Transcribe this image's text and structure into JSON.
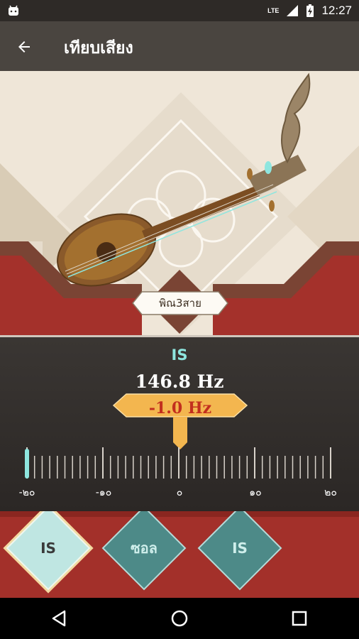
{
  "status_bar": {
    "time": "12:27",
    "network": "LTE"
  },
  "app_bar": {
    "title": "เทียบเสียง"
  },
  "instrument": {
    "name": "พิณ3สาย"
  },
  "tuner": {
    "note": "IS",
    "frequency": "146.8 Hz",
    "offset": "-1.0 Hz",
    "offset_value": -1.0,
    "scale_labels": [
      "-๒๐",
      "-๑๐",
      "๐",
      "๑๐",
      "๒๐"
    ]
  },
  "strings": [
    {
      "label": "IS",
      "selected": true
    },
    {
      "label": "ซอล",
      "selected": false
    },
    {
      "label": "IS",
      "selected": false
    }
  ],
  "colors": {
    "accent": "#8ee6df",
    "badge": "#f3b64f",
    "offset_text": "#c22f1e",
    "panel": "#a3302a"
  }
}
